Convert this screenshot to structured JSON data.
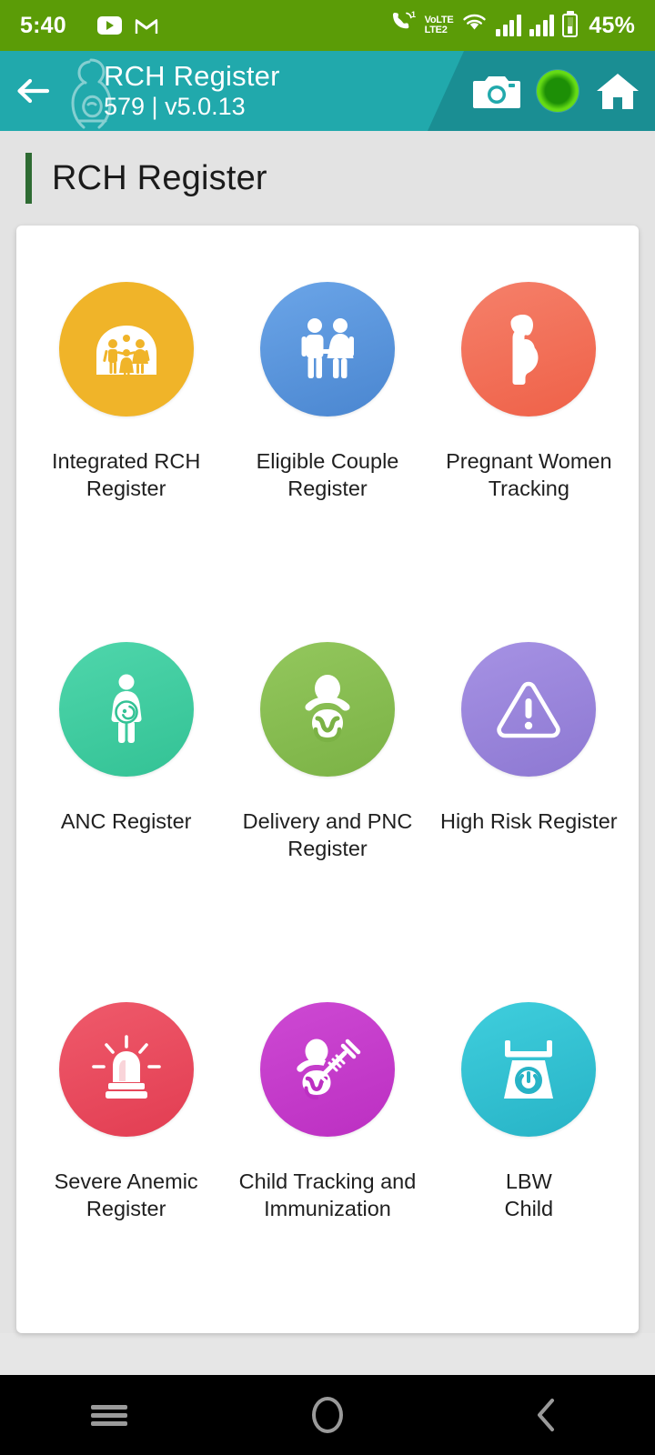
{
  "statusbar": {
    "time": "5:40",
    "youtube_icon": "youtube-icon",
    "gmail_icon": "gmail-icon",
    "call_icon": "call-forward-icon",
    "sim1_label": "1",
    "volte_top": "VoLTE",
    "volte_bottom": "LTE2",
    "wifi_icon": "wifi-icon",
    "signal1_icon": "signal-bars-icon",
    "signal2_icon": "signal-bars-icon",
    "battery_icon": "battery-icon",
    "battery_percent": "45%",
    "background_color": "#5b9c07"
  },
  "appbar": {
    "back_icon": "back-arrow-icon",
    "logo_icon": "mother-child-logo",
    "title": "RCH Register",
    "subtitle": "579 | v5.0.13",
    "camera_icon": "camera-icon",
    "sync_status_icon": "green-status-indicator",
    "home_icon": "home-icon",
    "background_color": "#21a9ac",
    "accent_color": "#1a8e93"
  },
  "page": {
    "title": "RCH Register",
    "accent_color": "#2e6b33",
    "background_color": "#e3e3e3"
  },
  "grid": {
    "tiles": [
      {
        "label": "Integrated RCH Register",
        "icon": "family-house-icon",
        "color": "#f0b429"
      },
      {
        "label": "Eligible Couple Register",
        "icon": "couple-icon",
        "color": "#5596e0"
      },
      {
        "label": "Pregnant Women\nTracking",
        "icon": "pregnant-woman-profile-icon",
        "color": "#f2705a"
      },
      {
        "label": "ANC Register",
        "icon": "pregnant-woman-fetus-icon",
        "color": "#3fce9f"
      },
      {
        "label": "Delivery and PNC\nRegister",
        "icon": "baby-icon",
        "color": "#85bc4f"
      },
      {
        "label": "High Risk Register",
        "icon": "warning-triangle-icon",
        "color": "#9781db"
      },
      {
        "label": "Severe Anemic Register",
        "icon": "siren-alarm-icon",
        "color": "#e84a5c"
      },
      {
        "label": "Child Tracking and\nImmunization",
        "icon": "baby-syringe-icon",
        "color": "#c33bc9"
      },
      {
        "label": "LBW\nChild",
        "icon": "weighing-scale-icon",
        "color": "#31bfd0"
      }
    ]
  },
  "navbar": {
    "recents_icon": "recents-icon",
    "home_icon": "home-circle-icon",
    "back_icon": "back-chevron-icon",
    "background_color": "#000000"
  }
}
